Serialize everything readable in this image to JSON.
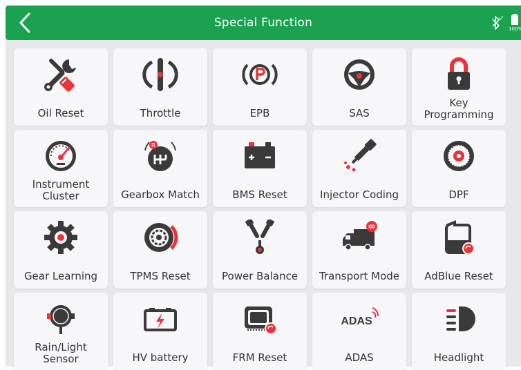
{
  "header": {
    "title": "Special Function",
    "battery_text": "100%"
  },
  "colors": {
    "header_green": "#1aa251",
    "icon_dark": "#3a3a3a",
    "icon_red": "#e8353c",
    "tile_bg": "#f7f7f9",
    "grid_bg": "#e8e8ea"
  },
  "functions": [
    {
      "label": "Oil Reset",
      "icon": "wrench-icon"
    },
    {
      "label": "Throttle",
      "icon": "throttle-icon"
    },
    {
      "label": "EPB",
      "icon": "parking-brake-icon"
    },
    {
      "label": "SAS",
      "icon": "steering-wheel-icon"
    },
    {
      "label": "Key Programming",
      "icon": "padlock-icon"
    },
    {
      "label": "Instrument Cluster",
      "icon": "gauge-icon"
    },
    {
      "label": "Gearbox Match",
      "icon": "gearbox-icon"
    },
    {
      "label": "BMS Reset",
      "icon": "car-battery-icon"
    },
    {
      "label": "Injector Coding",
      "icon": "injector-icon"
    },
    {
      "label": "DPF",
      "icon": "filter-icon"
    },
    {
      "label": "Gear Learning",
      "icon": "gear-icon"
    },
    {
      "label": "TPMS Reset",
      "icon": "tire-pressure-icon"
    },
    {
      "label": "Power Balance",
      "icon": "cylinders-icon"
    },
    {
      "label": "Transport Mode",
      "icon": "truck-icon"
    },
    {
      "label": "AdBlue Reset",
      "icon": "adblue-tank-icon"
    },
    {
      "label": "Rain/Light Sensor",
      "icon": "sensor-icon"
    },
    {
      "label": "HV battery",
      "icon": "hv-battery-icon"
    },
    {
      "label": "FRM Reset",
      "icon": "module-icon"
    },
    {
      "label": "ADAS",
      "icon": "adas-icon"
    },
    {
      "label": "Headlight",
      "icon": "headlight-icon"
    }
  ]
}
